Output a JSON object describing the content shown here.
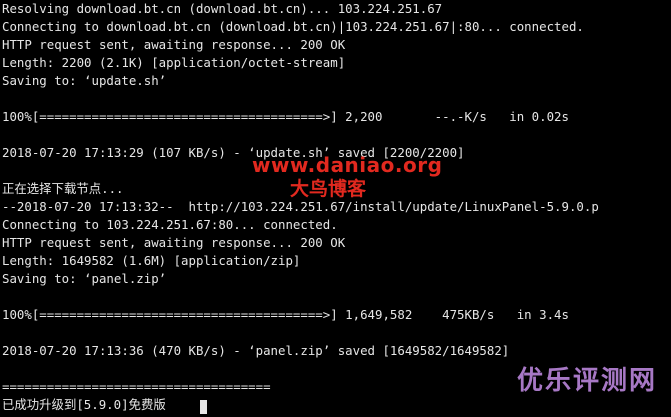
{
  "terminal": {
    "lines": [
      "Resolving download.bt.cn (download.bt.cn)... 103.224.251.67",
      "Connecting to download.bt.cn (download.bt.cn)|103.224.251.67|:80... connected.",
      "HTTP request sent, awaiting response... 200 OK",
      "Length: 2200 (2.1K) [application/octet-stream]",
      "Saving to: ‘update.sh’",
      "",
      "100%[======================================>] 2,200       --.-K/s   in 0.02s",
      "",
      "2018-07-20 17:13:29 (107 KB/s) - ‘update.sh’ saved [2200/2200]",
      "",
      "正在选择下载节点...",
      "--2018-07-20 17:13:32--  http://103.224.251.67/install/update/LinuxPanel-5.9.0.p",
      "Connecting to 103.224.251.67:80... connected.",
      "HTTP request sent, awaiting response... 200 OK",
      "Length: 1649582 (1.6M) [application/zip]",
      "Saving to: ‘panel.zip’",
      "",
      "100%[======================================>] 1,649,582    475KB/s   in 3.4s",
      "",
      "2018-07-20 17:13:36 (470 KB/s) - ‘panel.zip’ saved [1649582/1649582]",
      "",
      "====================================",
      "已成功升级到[5.9.0]免费版"
    ]
  },
  "watermarks": {
    "site": "www.daniao.org",
    "name": "大鸟博客",
    "corner": "优乐评测网"
  },
  "colors": {
    "background": "#000000",
    "text": "#e6e6e6",
    "watermark_red": "#e2291f",
    "watermark_purple": "#b07fd0"
  }
}
